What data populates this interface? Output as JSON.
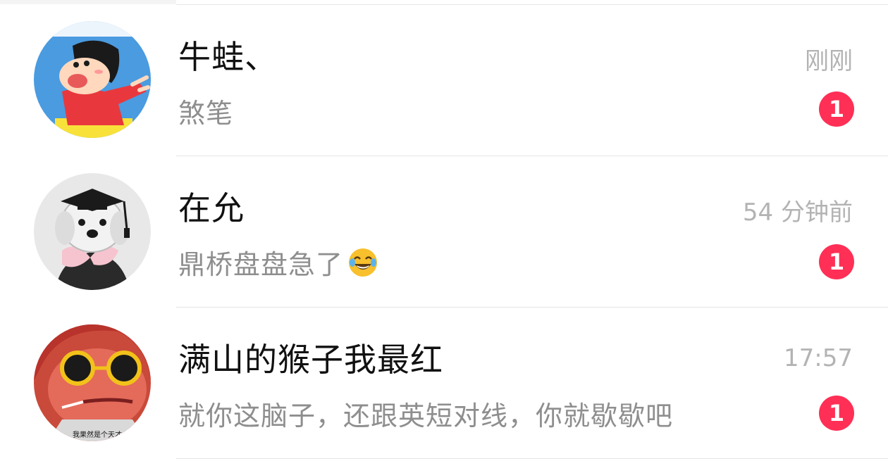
{
  "conversations": [
    {
      "name": "牛蛙、",
      "preview": "煞笔",
      "time": "刚刚",
      "unread": "1",
      "avatar_icon": "cartoon-boy-avatar"
    },
    {
      "name": "在允",
      "preview": "鼎桥盘盘急了",
      "preview_emoji": "laughing-tears-emoji",
      "time": "54 分钟前",
      "unread": "1",
      "avatar_icon": "dog-graduation-cap-avatar"
    },
    {
      "name": "满山的猴子我最红",
      "preview": "就你这脑子，还跟英短对线，你就歇歇吧",
      "time": "17:57",
      "unread": "1",
      "avatar_icon": "cartoon-sunglasses-avatar",
      "avatar_caption": "我果然是个天才"
    }
  ],
  "colors": {
    "badge": "#ff2f55",
    "name": "#111111",
    "preview": "#8e8e8e",
    "time": "#b3b3b3",
    "divider": "#e4e4e4"
  }
}
